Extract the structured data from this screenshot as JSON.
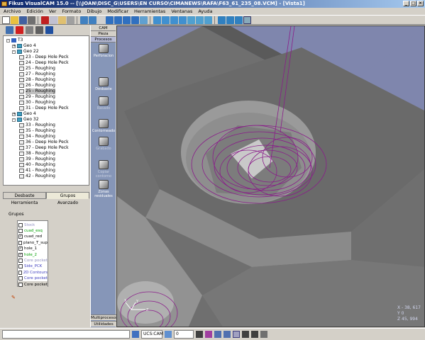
{
  "window": {
    "title": "Fikus VisualCAM 15.0 -- [\\\\JOAN\\DISC_G\\USERS\\EN CURSO\\CIMANEWS\\RAFA\\F63_61_235_08.VCM] - [Vista1]"
  },
  "menu": [
    "Archivo",
    "Edición",
    "Ver",
    "Formato",
    "Dibujo",
    "Modificar",
    "Herramientas",
    "Ventanas",
    "Ayuda"
  ],
  "tree": {
    "root": "T3",
    "nodes": [
      {
        "label": "Geo 4",
        "level": 1,
        "type": "geo",
        "pm": "+"
      },
      {
        "label": "Geo 22",
        "level": 1,
        "type": "geo",
        "pm": "-"
      },
      {
        "label": "23 - Deep Hole Peck",
        "level": 2,
        "type": "op"
      },
      {
        "label": "24 - Deep Hole Peck",
        "level": 2,
        "type": "op"
      },
      {
        "label": "25 - Roughing",
        "level": 2,
        "type": "op"
      },
      {
        "label": "27 - Roughing",
        "level": 2,
        "type": "op"
      },
      {
        "label": "28 - Roughing",
        "level": 2,
        "type": "op"
      },
      {
        "label": "26 - Roughing",
        "level": 2,
        "type": "op"
      },
      {
        "label": "25 - Roughing",
        "level": 2,
        "type": "op",
        "selected": true
      },
      {
        "label": "29 - Roughing",
        "level": 2,
        "type": "op"
      },
      {
        "label": "30 - Roughing",
        "level": 2,
        "type": "op"
      },
      {
        "label": "31 - Deep Hole Peck",
        "level": 2,
        "type": "op"
      },
      {
        "label": "Geo 4",
        "level": 1,
        "type": "geo",
        "pm": "+"
      },
      {
        "label": "Geo 32",
        "level": 1,
        "type": "geo",
        "pm": "-"
      },
      {
        "label": "33 - Roughing",
        "level": 2,
        "type": "op"
      },
      {
        "label": "35 - Roughing",
        "level": 2,
        "type": "op"
      },
      {
        "label": "34 - Roughing",
        "level": 2,
        "type": "op"
      },
      {
        "label": "36 - Deep Hole Peck",
        "level": 2,
        "type": "op"
      },
      {
        "label": "37 - Deep Hole Peck",
        "level": 2,
        "type": "op"
      },
      {
        "label": "38 - Roughing",
        "level": 2,
        "type": "op"
      },
      {
        "label": "39 - Roughing",
        "level": 2,
        "type": "op"
      },
      {
        "label": "40 - Roughing",
        "level": 2,
        "type": "op"
      },
      {
        "label": "41 - Roughing",
        "level": 2,
        "type": "op"
      },
      {
        "label": "42 - Roughing",
        "level": 2,
        "type": "op"
      }
    ]
  },
  "tabs": {
    "desbaste": "Desbaste",
    "grupos": "Grupos",
    "herramienta": "Herramienta",
    "avanzado": "Avanzado"
  },
  "groups": {
    "label": "Grupos",
    "items": [
      {
        "label": "Stock",
        "checked": false,
        "color": "#9090c0"
      },
      {
        "label": "cuad_esq",
        "checked": false,
        "color": "#00a000"
      },
      {
        "label": "cuad_red",
        "checked": true,
        "color": "#000000"
      },
      {
        "label": "plano_T_sup",
        "checked": false,
        "color": "#000000"
      },
      {
        "label": "hole_1",
        "checked": true,
        "color": "#000000"
      },
      {
        "label": "hole_2",
        "checked": true,
        "color": "#00a000"
      },
      {
        "label": "Core pocket",
        "checked": false,
        "color": "#9090c0"
      },
      {
        "label": "Side_PCK",
        "checked": false,
        "color": "#4040c0"
      },
      {
        "label": "2D Contours",
        "checked": false,
        "color": "#4040c0"
      },
      {
        "label": "Core pocket",
        "checked": false,
        "color": "#4040c0"
      },
      {
        "label": "Core pocket",
        "checked": false,
        "color": "#000000",
        "selected": true
      }
    ]
  },
  "process_panel": {
    "tabs": [
      "CAM",
      "Pieza",
      "Procesos"
    ],
    "items": [
      {
        "label": "Perforacion",
        "dim": false
      },
      {
        "label": "Desbaste",
        "dim": false
      },
      {
        "label": "Rasado",
        "dim": true
      },
      {
        "label": "Contorneado",
        "dim": false
      },
      {
        "label": "Grabado",
        "dim": true
      },
      {
        "label": "Copiar contorno",
        "dim": true
      },
      {
        "label": "Zonas residuales",
        "dim": false
      }
    ],
    "bottom_tabs": [
      "Multiprocesos",
      "Utilidades"
    ]
  },
  "viewport": {
    "coords": {
      "x": "X - 38, 617",
      "y": "Y 0",
      "z": "Z 45, 994"
    },
    "toolpath_color": "#8a1c8a"
  },
  "statusbar": {
    "ucs": "UCS:CAM",
    "layer": "0"
  },
  "colors": {
    "toolpath": "#8a1c8a",
    "background": "#7f86ad",
    "selection": "#c0c0c0"
  }
}
